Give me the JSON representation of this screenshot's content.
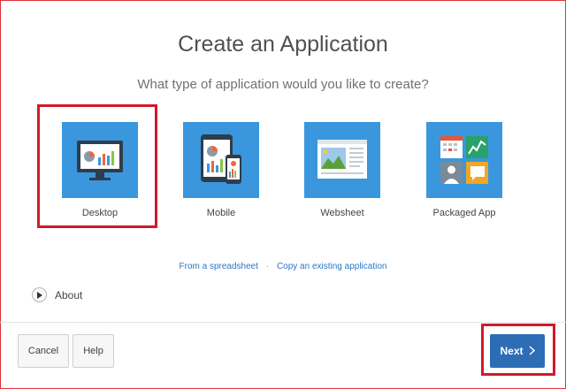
{
  "header": {
    "title": "Create an Application",
    "subtitle": "What type of application would you like to create?"
  },
  "options": [
    {
      "label": "Desktop",
      "icon": "desktop-monitor-icon",
      "selected": true
    },
    {
      "label": "Mobile",
      "icon": "mobile-devices-icon"
    },
    {
      "label": "Websheet",
      "icon": "websheet-icon"
    },
    {
      "label": "Packaged App",
      "icon": "packaged-app-icon"
    }
  ],
  "links": {
    "spreadsheet": "From a spreadsheet",
    "separator": "·",
    "copy": "Copy an existing application"
  },
  "about": {
    "label": "About",
    "icon": "play-triangle-icon"
  },
  "buttons": {
    "cancel": "Cancel",
    "help": "Help",
    "next": "Next",
    "next_icon": "chevron-right-icon"
  },
  "colors": {
    "tile": "#3a97dd",
    "highlight": "#d11a2a",
    "primary_button": "#2d6db6",
    "link": "#2a77c4"
  }
}
